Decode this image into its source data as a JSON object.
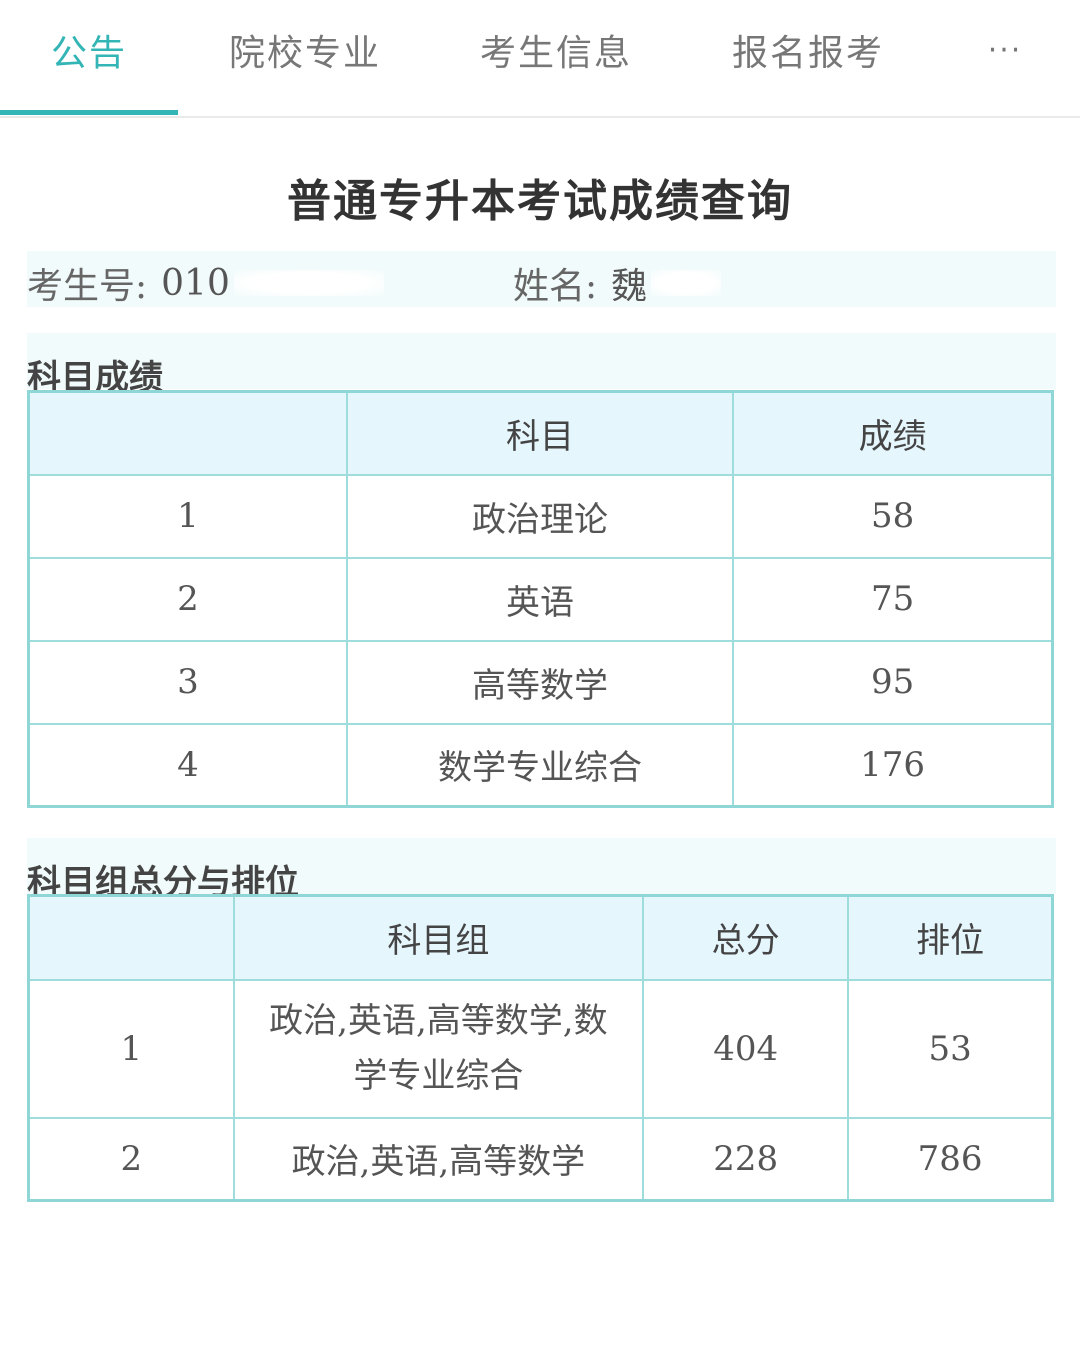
{
  "tabs": [
    {
      "label": "公告",
      "active": true
    },
    {
      "label": "院校专业",
      "active": false
    },
    {
      "label": "考生信息",
      "active": false
    },
    {
      "label": "报名报考",
      "active": false
    },
    {
      "label": "···",
      "active": false
    }
  ],
  "title": "普通专升本考试成绩查询",
  "candidate": {
    "id_label": "考生号:",
    "id_value": "010",
    "name_label": "姓名:",
    "name_value": "魏"
  },
  "subject_scores": {
    "heading": "科目成绩",
    "columns": [
      "",
      "科目",
      "成绩"
    ],
    "rows": [
      {
        "idx": "1",
        "subject": "政治理论",
        "score": "58"
      },
      {
        "idx": "2",
        "subject": "英语",
        "score": "75"
      },
      {
        "idx": "3",
        "subject": "高等数学",
        "score": "95"
      },
      {
        "idx": "4",
        "subject": "数学专业综合",
        "score": "176"
      }
    ]
  },
  "group_scores": {
    "heading": "科目组总分与排位",
    "columns": [
      "",
      "科目组",
      "总分",
      "排位"
    ],
    "rows": [
      {
        "idx": "1",
        "group": "政治,英语,高等数学,数学专业综合",
        "total": "404",
        "rank": "53"
      },
      {
        "idx": "2",
        "group": "政治,英语,高等数学",
        "total": "228",
        "rank": "786"
      }
    ]
  },
  "colors": {
    "accent": "#33b5b5",
    "header_bg": "#e6f6fd",
    "border": "#9fdcdc",
    "section_bg": "#f2fbfb"
  }
}
